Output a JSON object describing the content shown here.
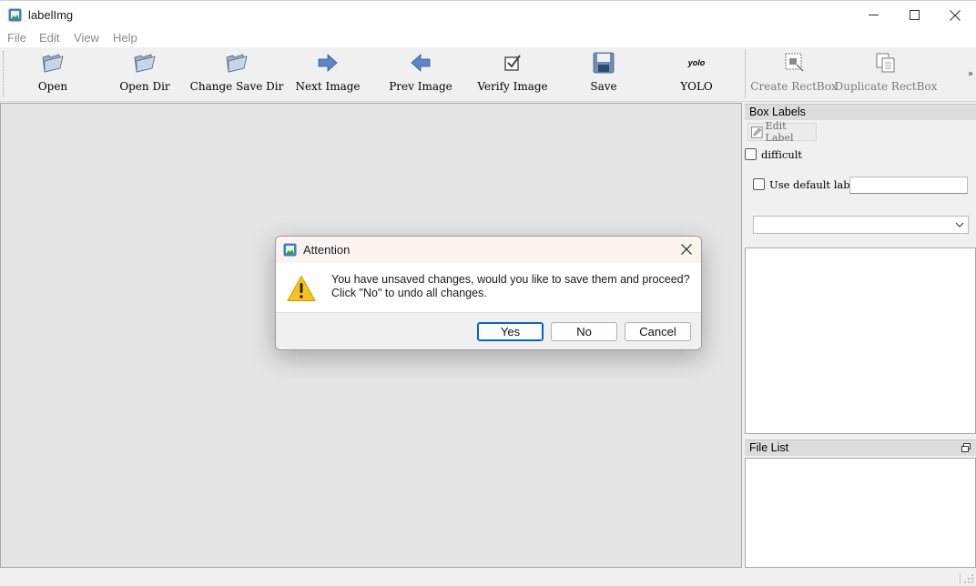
{
  "window": {
    "title": "labelImg",
    "controls": {
      "minimize": "minimize-icon",
      "maximize": "maximize-icon",
      "close": "close-icon"
    }
  },
  "menu": [
    "File",
    "Edit",
    "View",
    "Help"
  ],
  "toolbar": {
    "items": [
      {
        "label": "Open",
        "icon": "folder-open-icon"
      },
      {
        "label": "Open Dir",
        "icon": "folder-open-icon"
      },
      {
        "label": "Change Save Dir",
        "icon": "folder-open-icon"
      },
      {
        "label": "Next Image",
        "icon": "arrow-right-icon"
      },
      {
        "label": "Prev Image",
        "icon": "arrow-left-icon"
      },
      {
        "label": "Verify Image",
        "icon": "checkbox-icon"
      },
      {
        "label": "Save",
        "icon": "floppy-disk-icon"
      },
      {
        "label": "YOLO",
        "icon": "yolo-icon",
        "icon_text": "yolo"
      },
      {
        "label": "Create RectBox",
        "icon": "create-rect-icon",
        "disabled": true
      },
      {
        "label": "Duplicate RectBox",
        "icon": "duplicate-icon",
        "disabled": true
      }
    ],
    "overflow": "»"
  },
  "box_labels": {
    "title": "Box Labels",
    "edit_label": "Edit Label",
    "difficult": "difficult",
    "use_default_label": "Use default label",
    "default_label_value": "",
    "combo_value": ""
  },
  "file_list": {
    "title": "File List"
  },
  "dialog": {
    "title": "Attention",
    "message_line1": "You have unsaved changes, would you like to save them and proceed?",
    "message_line2": "Click \"No\" to undo all changes.",
    "buttons": {
      "yes": "Yes",
      "no": "No",
      "cancel": "Cancel"
    }
  },
  "colors": {
    "accent": "#0067c0",
    "warning": "#f5c518",
    "canvas": "#e5e5e5"
  }
}
